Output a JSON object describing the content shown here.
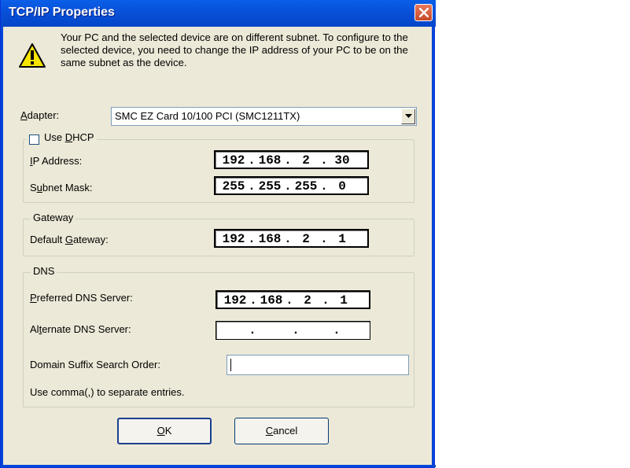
{
  "window": {
    "title": "TCP/IP Properties"
  },
  "message": "Your PC and the selected device are on different subnet. To configure to the selected device, you need to change the IP address of your PC to be on the same subnet as the device.",
  "adapter": {
    "label_accel": "A",
    "label_rest": "dapter:",
    "value": "SMC EZ Card 10/100 PCI (SMC1211TX)"
  },
  "dhcp": {
    "checkbox_pre": "Use ",
    "checkbox_accel": "D",
    "checkbox_post": "HCP",
    "checked": false,
    "ip_label_accel": "I",
    "ip_label_rest": "P Address:",
    "mask_label_pre": "S",
    "mask_label_accel": "u",
    "mask_label_post": "bnet Mask:",
    "ip_address": [
      "192",
      "168",
      "2",
      "30"
    ],
    "subnet_mask": [
      "255",
      "255",
      "255",
      "0"
    ]
  },
  "gateway": {
    "caption": "Gateway",
    "label_pre": "Default ",
    "label_accel": "G",
    "label_post": "ateway:",
    "value": [
      "192",
      "168",
      "2",
      "1"
    ]
  },
  "dns": {
    "caption": "DNS",
    "preferred_accel": "P",
    "preferred_rest": "referred DNS Server:",
    "alternate_pre": "Al",
    "alternate_accel": "t",
    "alternate_post": "ernate DNS Server:",
    "preferred_value": [
      "192",
      "168",
      "2",
      "1"
    ],
    "alternate_value": [
      "",
      "",
      "",
      ""
    ],
    "suffix_label": "Domain Suffix Search Order:",
    "suffix_value": "",
    "hint": "Use comma(,) to separate entries."
  },
  "buttons": {
    "ok_accel": "O",
    "ok_rest": "K",
    "cancel_accel": "C",
    "cancel_rest": "ancel"
  },
  "ip_separator": "."
}
